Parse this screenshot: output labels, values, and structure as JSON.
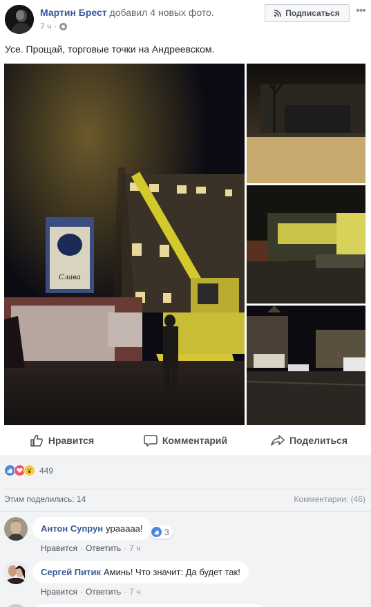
{
  "post": {
    "author": "Мартин Брест",
    "action": "добавил 4 новых фото.",
    "time": "7 ч",
    "separator": "·",
    "text": "Усе. Прощай, торговые точки на Андреевском."
  },
  "header": {
    "subscribe_label": "Подписаться",
    "more_label": "•••"
  },
  "actions": {
    "like_label": "Нравится",
    "comment_label": "Комментарий",
    "share_label": "Поделиться"
  },
  "stats": {
    "reaction_icons": [
      "like-icon",
      "love-icon",
      "wow-icon"
    ],
    "reactions_count": "449",
    "shares_label": "Этим поделились: 14",
    "comments_label": "Комментарии: (46)"
  },
  "comments": [
    {
      "author": "Антон Супрун",
      "text": "урааааа!",
      "reaction_count": "3",
      "like": "Нравится",
      "reply": "Ответить",
      "time": "7 ч"
    },
    {
      "author": "Сергей Питик",
      "text": "Аминь! Что значит: Да будет так!",
      "like": "Нравится",
      "reply": "Ответить",
      "time": "7 ч"
    }
  ],
  "colors": {
    "link_blue": "#365899",
    "text_dark": "#1d2129",
    "text_gray": "#616770",
    "muted_gray": "#90949c",
    "bg_gray": "#f2f3f5",
    "like_blue": "#4a85e5",
    "love_red": "#f25268",
    "wow_yellow": "#f7c945",
    "crane_yellow": "#d4c92a"
  }
}
